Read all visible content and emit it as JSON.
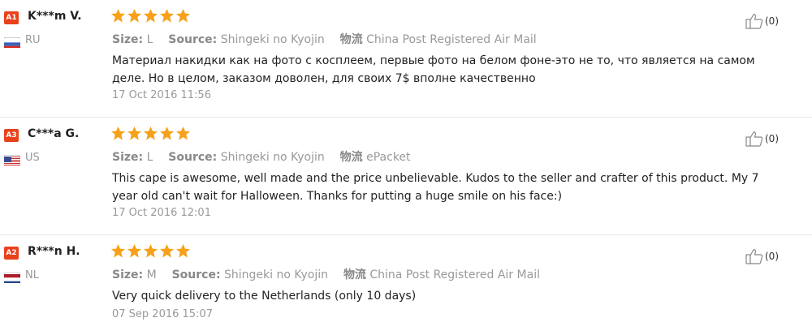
{
  "labels": {
    "size": "Size:",
    "source": "Source:",
    "shipping": "物流"
  },
  "reviews": [
    {
      "badge": "A1",
      "name": "K***m V.",
      "country": "RU",
      "flag": "ru-flag",
      "rating": 5,
      "size": "L",
      "source": "Shingeki no Kyojin",
      "shipping": "China Post Registered Air Mail",
      "text": "Материал накидки как на фото с косплеем, первые фото на белом фоне-это не то, что является на самом деле. Но в целом, заказом доволен, для своих 7$ вполне качественно",
      "date": "17 Oct 2016 11:56",
      "helpful": "(0)"
    },
    {
      "badge": "A3",
      "name": "C***a G.",
      "country": "US",
      "flag": "us-flag",
      "rating": 5,
      "size": "L",
      "source": "Shingeki no Kyojin",
      "shipping": "ePacket",
      "text": "This cape is awesome, well made and the price unbelievable. Kudos to the seller and crafter of this product. My 7 year old can't wait for Halloween. Thanks for putting a huge smile on his face:)",
      "date": "17 Oct 2016 12:01",
      "helpful": "(0)"
    },
    {
      "badge": "A2",
      "name": "R***n H.",
      "country": "NL",
      "flag": "nl-flag",
      "rating": 5,
      "size": "M",
      "source": "Shingeki no Kyojin",
      "shipping": "China Post Registered Air Mail",
      "text": "Very quick delivery to the Netherlands (only 10 days)",
      "date": "07 Sep 2016 15:07",
      "helpful": "(0)"
    }
  ],
  "colors": {
    "star": "#f7a11a",
    "badge": "#e8421c"
  }
}
